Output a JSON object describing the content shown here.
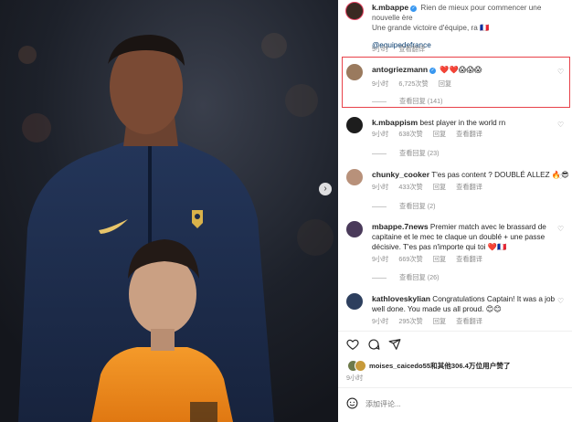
{
  "post": {
    "author": "k.mbappe",
    "caption": "Rien de mieux pour commencer une nouvelle ère",
    "caption2": "Une grande victoire d'équipe, ra",
    "flag": "🇫🇷",
    "mention": "@equipedefrance",
    "time": "9小时",
    "translate": "查看翻译"
  },
  "comments": [
    {
      "user": "antogriezmann",
      "text": "❤️❤️😱😱😱",
      "time": "9小时",
      "likes": "6,725次赞",
      "reply": "回复",
      "translate": "",
      "view_replies": "查看回复 (141)"
    },
    {
      "user": "k.mbappism",
      "text": "best player in the world rn",
      "time": "9小时",
      "likes": "638次赞",
      "reply": "回复",
      "translate": "查看翻译",
      "view_replies": "查看回复 (23)"
    },
    {
      "user": "chunky_cooker",
      "text": "T'es pas content ? DOUBLÉ ALLEZ 🔥😎",
      "time": "9小时",
      "likes": "433次赞",
      "reply": "回复",
      "translate": "查看翻译",
      "view_replies": "查看回复 (2)"
    },
    {
      "user": "mbappe.7news",
      "text": "Premier match avec le brassard de capitaine et le mec te claque un doublé + une passe décisive. T'es pas n'importe qui toi ❤️🇫🇷",
      "time": "9小时",
      "likes": "669次赞",
      "reply": "回复",
      "translate": "查看翻译",
      "view_replies": "查看回复 (26)"
    },
    {
      "user": "kathloveskylian",
      "text": "Congratulations Captain! It was a job well done. You made us all proud. 😊😊",
      "time": "9小时",
      "likes": "295次赞",
      "reply": "回复",
      "translate": "查看翻译",
      "view_replies": ""
    }
  ],
  "likes_summary": {
    "user": "moises_caicedo55",
    "rest": "和其他306.4万位用户赞了",
    "time": "9小时"
  },
  "add_comment": {
    "placeholder": "添加评论..."
  },
  "icons": {
    "like": "heart-outline-icon",
    "comment": "comment-icon",
    "share": "paper-plane-icon",
    "emoji": "emoji-icon",
    "next": "chevron-right-icon"
  },
  "colors": {
    "highlight": "#e8424a",
    "verified": "#3897f0",
    "jersey": "#1c2b4a",
    "kid_jersey": "#f08a1c"
  }
}
